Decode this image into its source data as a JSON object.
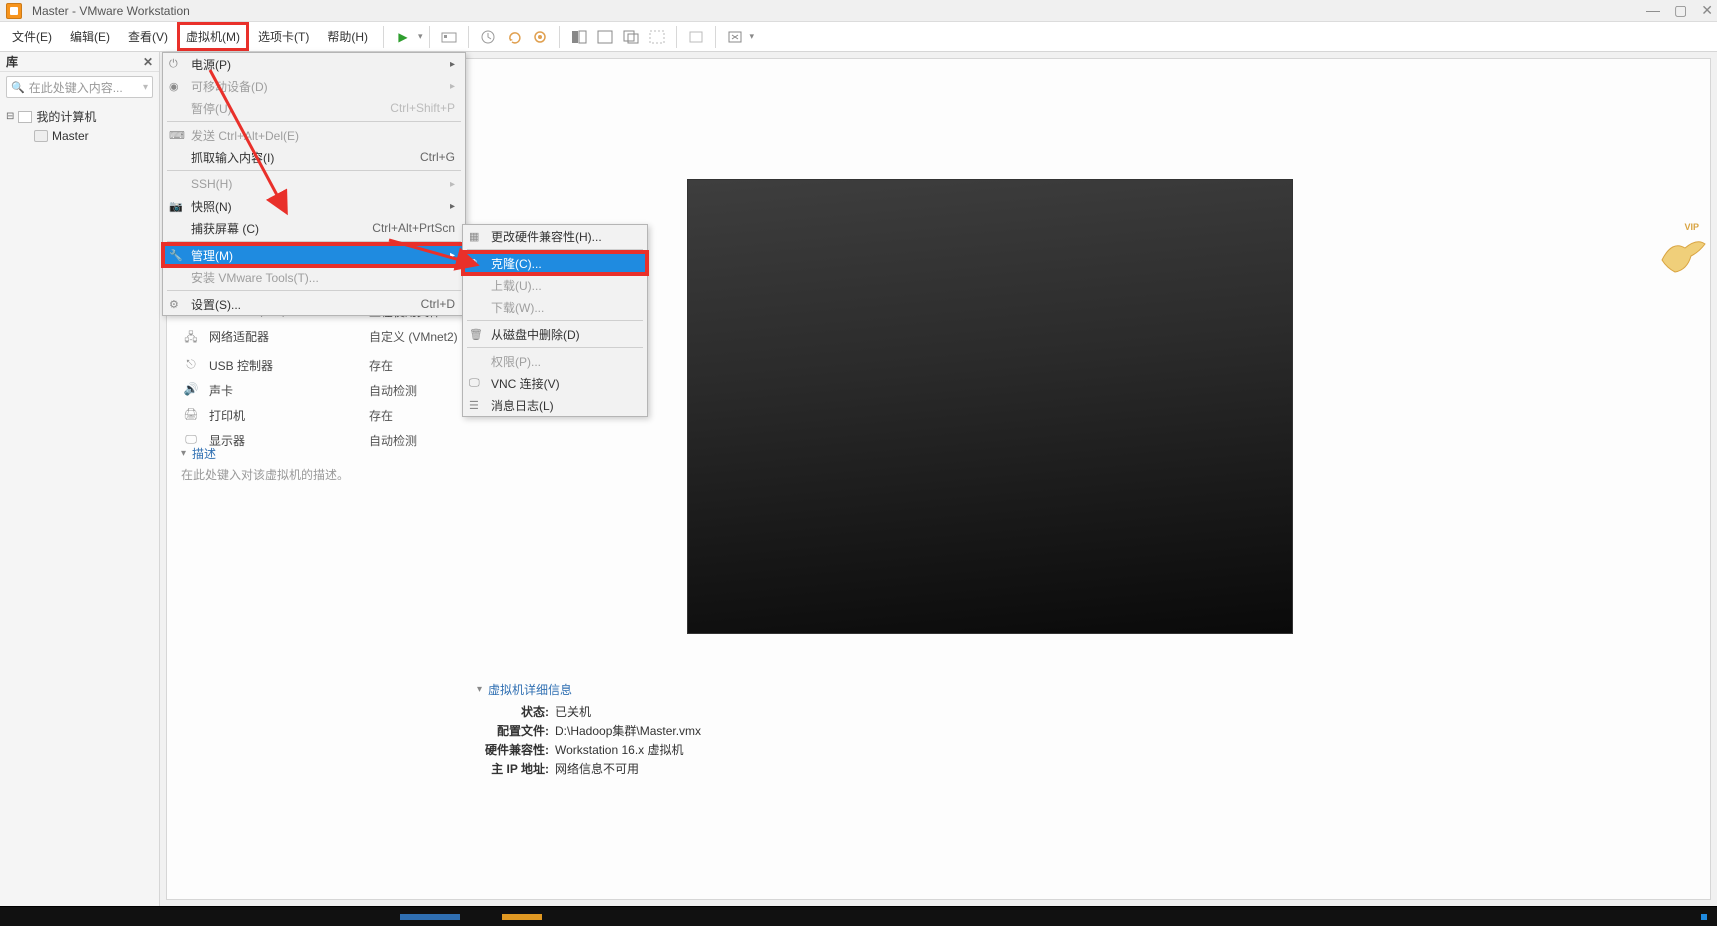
{
  "window": {
    "title": "Master - VMware Workstation"
  },
  "menubar": {
    "file": "文件(E)",
    "edit": "编辑(E)",
    "view": "查看(V)",
    "vm": "虚拟机(M)",
    "tabs": "选项卡(T)",
    "help": "帮助(H)"
  },
  "sidebar": {
    "header": "库",
    "search_placeholder": "在此处键入内容...",
    "root": "我的计算机",
    "vm_node": "Master"
  },
  "vm_menu": {
    "power": "电源(P)",
    "removable": "可移动设备(D)",
    "pause": "暂停(U)",
    "pause_short": "Ctrl+Shift+P",
    "send_cad": "发送 Ctrl+Alt+Del(E)",
    "grab_input": "抓取输入内容(I)",
    "grab_short": "Ctrl+G",
    "ssh": "SSH(H)",
    "snapshot": "快照(N)",
    "capture": "捕获屏幕 (C)",
    "capture_short": "Ctrl+Alt+PrtScn",
    "manage": "管理(M)",
    "install_tools": "安装 VMware Tools(T)...",
    "settings": "设置(S)...",
    "settings_short": "Ctrl+D"
  },
  "manage_submenu": {
    "change_hw": "更改硬件兼容性(H)...",
    "clone": "克隆(C)...",
    "upload": "上载(U)...",
    "download": "下载(W)...",
    "delete_disk": "从磁盘中删除(D)",
    "permissions": "权限(P)...",
    "vnc": "VNC 连接(V)",
    "msg_log": "消息日志(L)"
  },
  "hardware": {
    "cddvd_name": "CD/DVD (IDE)",
    "cddvd_val": "正在使用文件 F...",
    "net_name": "网络适配器",
    "net_val": "自定义 (VMnet2)",
    "usb_name": "USB 控制器",
    "usb_val": "存在",
    "sound_name": "声卡",
    "sound_val": "自动检测",
    "printer_name": "打印机",
    "printer_val": "存在",
    "display_name": "显示器",
    "display_val": "自动检测"
  },
  "desc": {
    "title": "描述",
    "hint": "在此处键入对该虚拟机的描述。"
  },
  "details": {
    "title": "虚拟机详细信息",
    "state_lab": "状态:",
    "state_val": "已关机",
    "config_lab": "配置文件:",
    "config_val": "D:\\Hadoop集群\\Master.vmx",
    "hwcompat_lab": "硬件兼容性:",
    "hwcompat_val": "Workstation 16.x 虚拟机",
    "ip_lab": "主 IP 地址:",
    "ip_val": "网络信息不可用"
  },
  "vip": "VIP"
}
